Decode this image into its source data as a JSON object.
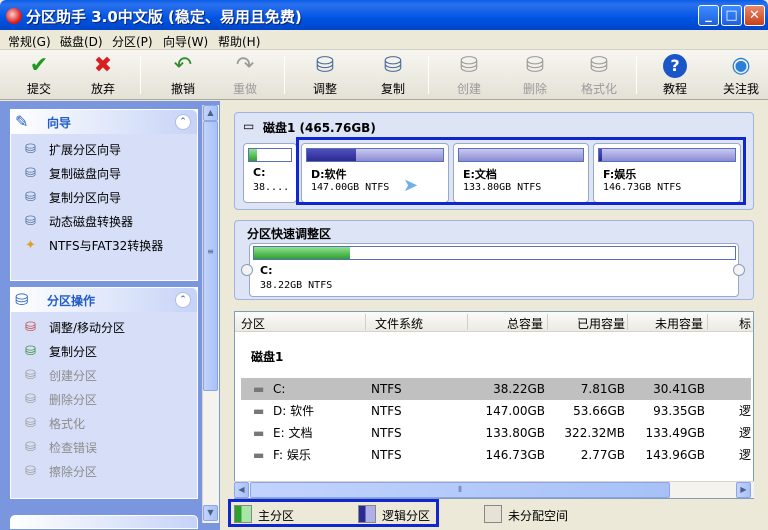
{
  "window": {
    "title": "分区助手 3.0中文版 (稳定、易用且免费)"
  },
  "menu": [
    "常规(G)",
    "磁盘(D)",
    "分区(P)",
    "向导(W)",
    "帮助(H)"
  ],
  "toolbar": {
    "commit": "提交",
    "discard": "放弃",
    "undo": "撤销",
    "redo": "重做",
    "resize": "调整",
    "copy": "复制",
    "create": "创建",
    "delete": "删除",
    "format": "格式化",
    "tutorial": "教程",
    "follow": "关注我"
  },
  "wizard_panel": {
    "title": "向导",
    "items": [
      "扩展分区向导",
      "复制磁盘向导",
      "复制分区向导",
      "动态磁盘转换器",
      "NTFS与FAT32转换器"
    ]
  },
  "ops_panel": {
    "title": "分区操作",
    "items": [
      "调整/移动分区",
      "复制分区",
      "创建分区",
      "删除分区",
      "格式化",
      "检查错误",
      "擦除分区"
    ]
  },
  "disk_map": {
    "title": "磁盘1 (465.76GB)",
    "partitions": [
      {
        "name": "C:",
        "size": "38....",
        "type": "primary",
        "used_fraction": 0.2
      },
      {
        "name": "D:软件",
        "size": "147.00GB NTFS",
        "type": "logical",
        "used_fraction": 0.36
      },
      {
        "name": "E:文档",
        "size": "133.80GB NTFS",
        "type": "logical",
        "used_fraction": 0.0
      },
      {
        "name": "F:娱乐",
        "size": "146.73GB NTFS",
        "type": "logical",
        "used_fraction": 0.02
      }
    ]
  },
  "resize_area": {
    "title": "分区快速调整区",
    "partition": "C:",
    "size": "38.22GB NTFS",
    "used_fraction": 0.2
  },
  "table": {
    "columns": [
      "分区",
      "文件系统",
      "总容量",
      "已用容量",
      "未用容量",
      "标"
    ],
    "disk_label": "磁盘1",
    "rows": [
      {
        "name": "C:",
        "fs": "NTFS",
        "total": "38.22GB",
        "used": "7.81GB",
        "free": "30.41GB",
        "flag": ""
      },
      {
        "name": "D: 软件",
        "fs": "NTFS",
        "total": "147.00GB",
        "used": "53.66GB",
        "free": "93.35GB",
        "flag": "逻"
      },
      {
        "name": "E: 文档",
        "fs": "NTFS",
        "total": "133.80GB",
        "used": "322.32MB",
        "free": "133.49GB",
        "flag": "逻"
      },
      {
        "name": "F: 娱乐",
        "fs": "NTFS",
        "total": "146.73GB",
        "used": "2.77GB",
        "free": "143.96GB",
        "flag": "逻"
      }
    ]
  },
  "legend": {
    "primary": "主分区",
    "logical": "逻辑分区",
    "unallocated": "未分配空间"
  },
  "colors": {
    "primary": "#2ea02e",
    "logical": "#2a2a90",
    "highlight": "#1026cf",
    "panel_bg": "#7a96df"
  }
}
